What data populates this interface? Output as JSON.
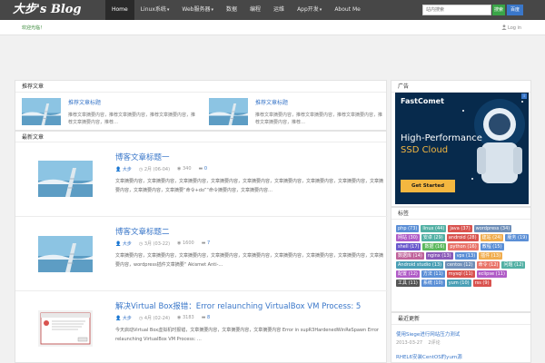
{
  "header": {
    "logo": "大步's Blog",
    "nav": [
      {
        "label": "Home",
        "caret": false
      },
      {
        "label": "Linux系统",
        "caret": true
      },
      {
        "label": "Web服务器",
        "caret": true
      },
      {
        "label": "数据",
        "caret": false
      },
      {
        "label": "编程",
        "caret": false
      },
      {
        "label": "运维",
        "caret": false
      },
      {
        "label": "App开发",
        "caret": true
      },
      {
        "label": "About Me",
        "caret": false
      }
    ],
    "search_placeholder": "站内搜索",
    "search_button": "搜索",
    "baidu_button": "百度",
    "caret_glyph": "▾"
  },
  "subbar": {
    "welcome": "欢迎光临！",
    "login": "Log in"
  },
  "featured": {
    "title": "推荐文章",
    "items": [
      {
        "title": "推荐文章标题",
        "desc": "推荐文章摘要内容，推荐文章摘要内容，推荐文章摘要内容，推荐文章摘要内容，推荐…"
      },
      {
        "title": "推荐文章标题",
        "desc": "推荐文章摘要内容，推荐文章摘要内容，推荐文章摘要内容，推荐文章摘要内容，推荐…"
      }
    ]
  },
  "latest": {
    "title": "最新文章",
    "posts": [
      {
        "title": "博客文章标题一",
        "author": "大步",
        "date": "2月 (06-04)",
        "views": "340",
        "comments": "0",
        "desc": "文章摘要内容，文章摘要内容，文章摘要内容，文章摘要内容，文章摘要内容，文章摘要内容，文章摘要内容，文章摘要内容，文章摘要内容，文章摘要内容，文章摘要“命令+do”“命令摘要内容，文章摘要内容…"
      },
      {
        "title": "博客文章标题二",
        "author": "大步",
        "date": "3月 (03-22)",
        "views": "1600",
        "comments": "7",
        "desc": "文章摘要内容，文章摘要内容，文章摘要内容，文章摘要内容，文章摘要内容，文章摘要内容，文章摘要内容，文章摘要内容，文章摘要内容，wordpress插件文章摘要“ Akismet Anti-…"
      },
      {
        "title": "解决Virtual Box报错：Error relaunching VirtualBox VM Process: 5",
        "author": "大步",
        "date": "4月 (02-24)",
        "views": "3183",
        "comments": "8",
        "desc": "今天启动Virtual Box虚拟机时报错，文章摘要内容，文章摘要内容，文章摘要内容 Error in supR3HardenedWinReSpawn Error relaunching VirtualBox VM Process: …"
      }
    ]
  },
  "sidebar": {
    "ad_title": "广告",
    "ad": {
      "brand": "FastComet",
      "headline_1": "High-Performance",
      "headline_2": "SSD Cloud",
      "cta": "Get Started",
      "info": "i"
    },
    "tags_title": "标签",
    "tags": [
      {
        "label": "php (73)",
        "color": "#5b8fd6"
      },
      {
        "label": "linux (44)",
        "color": "#52b0a4"
      },
      {
        "label": "java (37)",
        "color": "#d9534f"
      },
      {
        "label": "wordpress (34)",
        "color": "#6f8fb8"
      },
      {
        "label": "网站 (30)",
        "color": "#b05cc7"
      },
      {
        "label": "安卓 (29)",
        "color": "#52b0a4"
      },
      {
        "label": "android (28)",
        "color": "#d9534f"
      },
      {
        "label": "建站 (24)",
        "color": "#f0ad4e"
      },
      {
        "label": "服务 (19)",
        "color": "#5b8fd6"
      },
      {
        "label": "shell (17)",
        "color": "#6a5acd"
      },
      {
        "label": "数据 (16)",
        "color": "#5cb85c"
      },
      {
        "label": "python (16)",
        "color": "#e9746a"
      },
      {
        "label": "教程 (15)",
        "color": "#5b8fd6"
      },
      {
        "label": "数据库 (14)",
        "color": "#c0639b"
      },
      {
        "label": "nginx (13)",
        "color": "#8a5ab8"
      },
      {
        "label": "vps (13)",
        "color": "#5b8fd6"
      },
      {
        "label": "插件 (13)",
        "color": "#f0ad4e"
      },
      {
        "label": "Android studio (13)",
        "color": "#4a9fb5"
      },
      {
        "label": "centos (12)",
        "color": "#6f8fb8"
      },
      {
        "label": "命令 (12)",
        "color": "#e9746a"
      },
      {
        "label": "问题 (12)",
        "color": "#52b0a4"
      },
      {
        "label": "配置 (12)",
        "color": "#b05cc7"
      },
      {
        "label": "方法 (11)",
        "color": "#5b8fd6"
      },
      {
        "label": "mysql (11)",
        "color": "#d9534f"
      },
      {
        "label": "eclipse (11)",
        "color": "#b05cc7"
      },
      {
        "label": "工具 (11)",
        "color": "#555555"
      },
      {
        "label": "系统 (10)",
        "color": "#5b8fd6"
      },
      {
        "label": "yum (10)",
        "color": "#4a9fb5"
      },
      {
        "label": "rss (9)",
        "color": "#d9534f"
      }
    ],
    "recent_title": "最近更新",
    "recent": [
      {
        "title": "使用Siege进行网站压力测试",
        "date": "2013-03-27",
        "comments": "2评论"
      },
      {
        "title": "RHEL6安装CentOS的yum源",
        "date": "",
        "comments": ""
      }
    ]
  }
}
